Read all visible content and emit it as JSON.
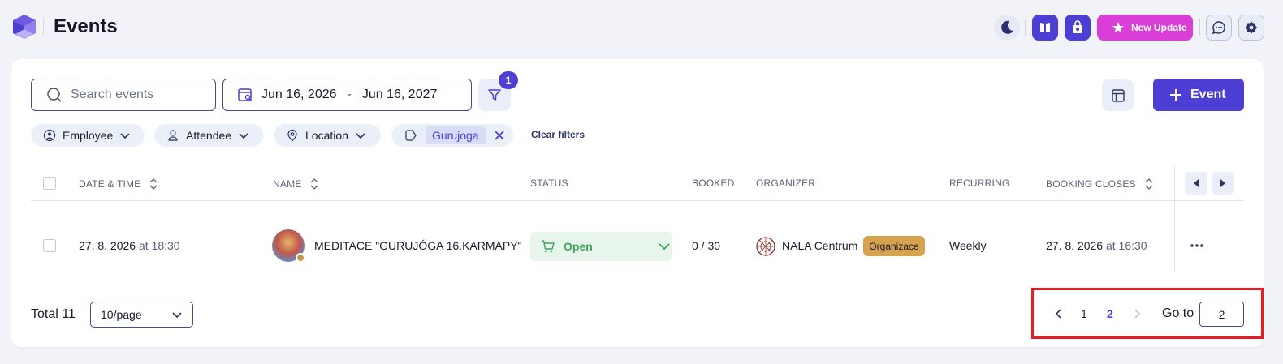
{
  "header": {
    "title": "Events",
    "new_update_label": "New Update"
  },
  "toolbar": {
    "search_placeholder": "Search events",
    "date_from": "Jun 16, 2026",
    "date_separator": "-",
    "date_to": "Jun 16, 2027",
    "filter_count": "1",
    "add_event_label": "Event"
  },
  "filters": {
    "employee": "Employee",
    "attendee": "Attendee",
    "location": "Location",
    "tag": "Gurujoga",
    "clear_label": "Clear filters"
  },
  "table": {
    "columns": [
      "DATE & TIME",
      "NAME",
      "STATUS",
      "BOOKED",
      "ORGANIZER",
      "RECURRING",
      "BOOKING CLOSES"
    ],
    "rows": [
      {
        "date": "27. 8. 2026",
        "at": "at",
        "time": "18:30",
        "name": "MEDITACE \"GURUJÓGA 16.KARMAPY\"",
        "status": "Open",
        "booked": "0 / 30",
        "organizer": "NALA Centrum",
        "organizer_badge": "Organizace",
        "recurring": "Weekly",
        "closes_date": "27. 8. 2026",
        "closes_at": "at",
        "closes_time": "16:30"
      }
    ]
  },
  "footer": {
    "total_label": "Total 11",
    "page_size": "10/page",
    "pages": [
      "1",
      "2"
    ],
    "current_page": "2",
    "goto_label": "Go to",
    "goto_value": "2"
  },
  "colors": {
    "primary": "#4d3fd4",
    "update_button": "#d93ed6",
    "status_open": "#3aa657",
    "organizer_badge": "#d6a24e",
    "highlight_box": "#ea1b22"
  }
}
